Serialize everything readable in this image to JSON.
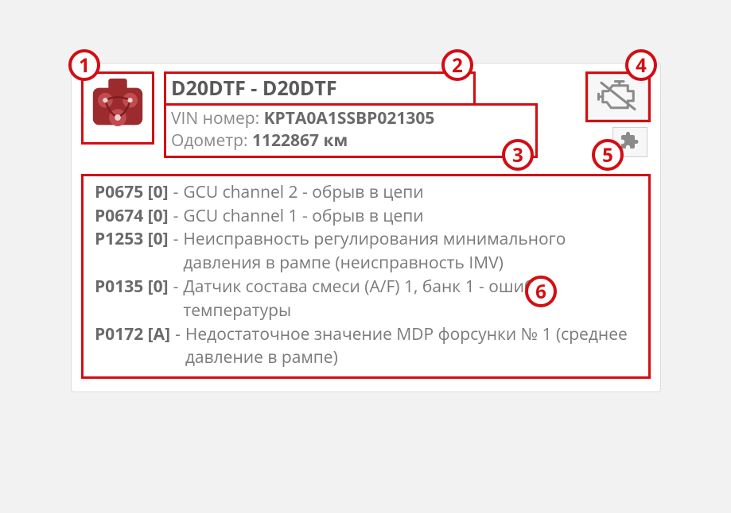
{
  "header": {
    "title": "D20DTF - D20DTF",
    "vin_label": "VIN номер:",
    "vin_value": "KPTA0A1SSBP021305",
    "odo_label": "Одометр:",
    "odo_value": "1122867 км"
  },
  "dtc": {
    "sep": " - ",
    "list": [
      {
        "code": "P0675 [0]",
        "desc": "GCU channel 2 - обрыв в цепи"
      },
      {
        "code": "P0674 [0]",
        "desc": "GCU channel 1 - обрыв в цепи"
      },
      {
        "code": "P1253 [0]",
        "desc": "Неисправность регулирования минимального давления в рампе (неисправность IMV)"
      },
      {
        "code": "P0135 [0]",
        "desc": "Датчик состава смеси (A/F) 1, банк 1 - ошибка температуры"
      },
      {
        "code": "P0172 [A]",
        "desc": "Недостаточное значение MDP форсунки № 1 (среднее давление в рампе)"
      }
    ]
  },
  "markers": {
    "m1": "1",
    "m2": "2",
    "m3": "3",
    "m4": "4",
    "m5": "5",
    "m6": "6"
  }
}
